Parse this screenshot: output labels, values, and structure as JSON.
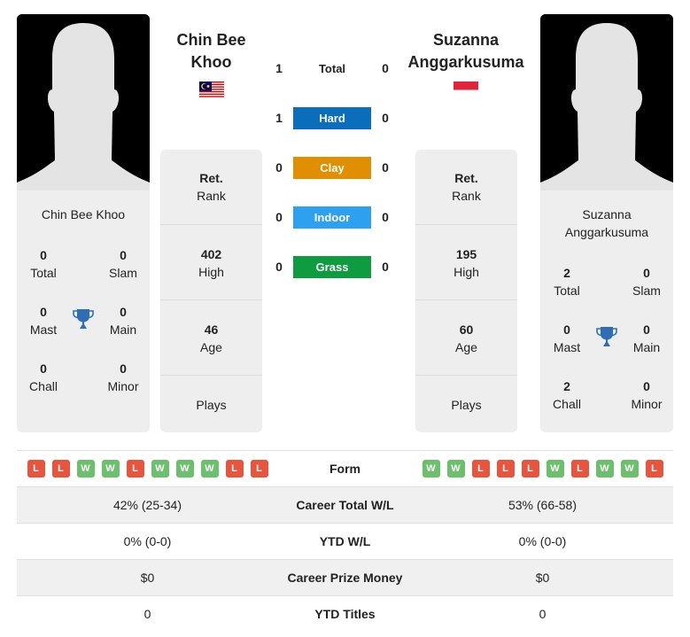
{
  "colors": {
    "hard": "#0a6ebd",
    "clay": "#e08f00",
    "indoor": "#2ea0f0",
    "grass": "#0f9b3f",
    "win": "#6cbf6c",
    "loss": "#e8553e",
    "trophy": "#2f6db5"
  },
  "player1": {
    "name": "Chin Bee Khoo",
    "header_name_line1": "Chin Bee",
    "header_name_line2": "Khoo",
    "flag": "Malaysia",
    "card_name": "Chin Bee Khoo",
    "titles": {
      "total": {
        "value": "0",
        "label": "Total"
      },
      "slam": {
        "value": "0",
        "label": "Slam"
      },
      "mast": {
        "value": "0",
        "label": "Mast"
      },
      "main": {
        "value": "0",
        "label": "Main"
      },
      "chall": {
        "value": "0",
        "label": "Chall"
      },
      "minor": {
        "value": "0",
        "label": "Minor"
      }
    },
    "rank": {
      "value": "Ret.",
      "label": "Rank"
    },
    "high": {
      "value": "402",
      "label": "High"
    },
    "age": {
      "value": "46",
      "label": "Age"
    },
    "plays": {
      "label": "Plays"
    },
    "form": [
      "L",
      "L",
      "W",
      "W",
      "L",
      "W",
      "W",
      "W",
      "L",
      "L"
    ],
    "career_wl": "42% (25-34)",
    "ytd_wl": "0% (0-0)",
    "prize_money": "$0",
    "ytd_titles": "0"
  },
  "player2": {
    "name": "Suzanna Anggarkusuma",
    "header_name_line1": "Suzanna",
    "header_name_line2": "Anggarkusuma",
    "flag": "Indonesia",
    "card_name_line1": "Suzanna",
    "card_name_line2": "Anggarkusuma",
    "titles": {
      "total": {
        "value": "2",
        "label": "Total"
      },
      "slam": {
        "value": "0",
        "label": "Slam"
      },
      "mast": {
        "value": "0",
        "label": "Mast"
      },
      "main": {
        "value": "0",
        "label": "Main"
      },
      "chall": {
        "value": "2",
        "label": "Chall"
      },
      "minor": {
        "value": "0",
        "label": "Minor"
      }
    },
    "rank": {
      "value": "Ret.",
      "label": "Rank"
    },
    "high": {
      "value": "195",
      "label": "High"
    },
    "age": {
      "value": "60",
      "label": "Age"
    },
    "plays": {
      "label": "Plays"
    },
    "form": [
      "W",
      "W",
      "L",
      "L",
      "L",
      "W",
      "L",
      "W",
      "W",
      "L"
    ],
    "career_wl": "53% (66-58)",
    "ytd_wl": "0% (0-0)",
    "prize_money": "$0",
    "ytd_titles": "0"
  },
  "h2h": [
    {
      "label": "Total",
      "p1": "1",
      "p2": "0",
      "key": "total"
    },
    {
      "label": "Hard",
      "p1": "1",
      "p2": "0",
      "key": "hard"
    },
    {
      "label": "Clay",
      "p1": "0",
      "p2": "0",
      "key": "clay"
    },
    {
      "label": "Indoor",
      "p1": "0",
      "p2": "0",
      "key": "indoor"
    },
    {
      "label": "Grass",
      "p1": "0",
      "p2": "0",
      "key": "grass"
    }
  ],
  "table": {
    "form_label": "Form",
    "career_wl_label": "Career Total W/L",
    "ytd_wl_label": "YTD W/L",
    "prize_label": "Career Prize Money",
    "ytd_titles_label": "YTD Titles"
  }
}
